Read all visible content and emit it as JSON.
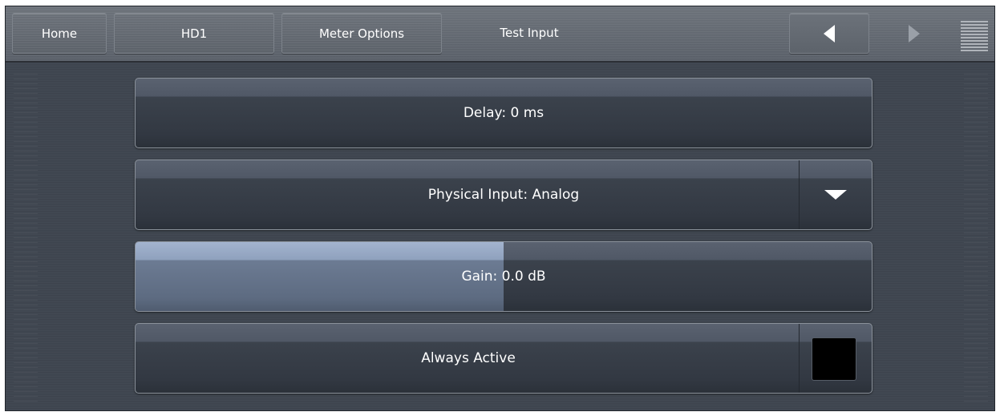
{
  "nav": {
    "tabs": [
      {
        "label": "Home"
      },
      {
        "label": "HD1"
      },
      {
        "label": "Meter Options"
      },
      {
        "label": "Test Input"
      }
    ],
    "active_tab": "Test Input",
    "prev_icon": "triangle-left-icon",
    "next_icon": "triangle-right-icon",
    "menu_icon": "menu-lines-icon"
  },
  "controls": {
    "delay": {
      "label": "Delay: 0 ms"
    },
    "physical_input": {
      "label": "Physical Input: Analog",
      "icon": "dropdown-triangle-icon"
    },
    "gain": {
      "label": "Gain: 0.0 dB",
      "level_fraction": 0.5
    },
    "always_active": {
      "label": "Always Active",
      "checked": false
    }
  },
  "colors": {
    "background": "#3e454f",
    "gain_fill": "#8fa1bd",
    "text": "#ffffff"
  }
}
